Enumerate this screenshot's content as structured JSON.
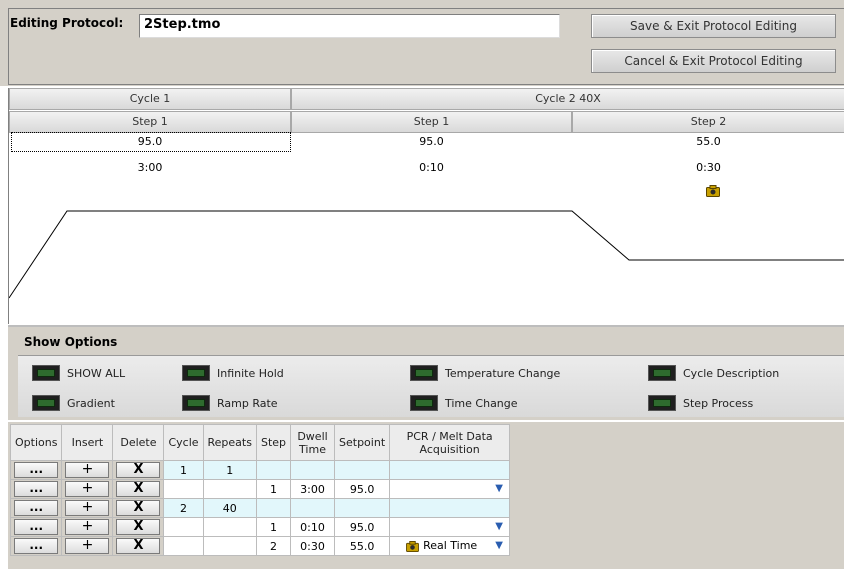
{
  "header": {
    "label": "Editing Protocol:",
    "filename": "2Step.tmo",
    "save_button": "Save & Exit Protocol Editing",
    "cancel_button": "Cancel & Exit Protocol Editing"
  },
  "graph": {
    "cycles": [
      {
        "label": "Cycle 1",
        "steps": [
          {
            "label": "Step 1",
            "setpoint": "95.0",
            "time": "3:00",
            "camera": false
          }
        ]
      },
      {
        "label": "Cycle 2 40X",
        "steps": [
          {
            "label": "Step 1",
            "setpoint": "95.0",
            "time": "0:10",
            "camera": false
          },
          {
            "label": "Step 2",
            "setpoint": "55.0",
            "time": "0:30",
            "camera": true
          }
        ]
      }
    ]
  },
  "show_options": {
    "title": "Show Options",
    "toggles": [
      {
        "label": "SHOW ALL"
      },
      {
        "label": "Gradient"
      },
      {
        "label": "Infinite Hold"
      },
      {
        "label": "Ramp Rate"
      },
      {
        "label": "Temperature Change"
      },
      {
        "label": "Time Change"
      },
      {
        "label": "Cycle Description"
      },
      {
        "label": "Step Process"
      }
    ]
  },
  "table": {
    "headers": [
      "Options",
      "Insert",
      "Delete",
      "Cycle",
      "Repeats",
      "Step",
      "Dwell Time",
      "Setpoint",
      "PCR / Melt Data Acquisition"
    ],
    "button_labels": {
      "options": "...",
      "insert": "+",
      "delete": "X"
    },
    "rows": [
      {
        "cycle": "1",
        "repeats": "1",
        "step": "",
        "dwell": "",
        "setpoint": "",
        "acquisition": "",
        "camera": false,
        "dropdown": false
      },
      {
        "cycle": "",
        "repeats": "",
        "step": "1",
        "dwell": "3:00",
        "setpoint": "95.0",
        "acquisition": "",
        "camera": false,
        "dropdown": true
      },
      {
        "cycle": "2",
        "repeats": "40",
        "step": "",
        "dwell": "",
        "setpoint": "",
        "acquisition": "",
        "camera": false,
        "dropdown": false
      },
      {
        "cycle": "",
        "repeats": "",
        "step": "1",
        "dwell": "0:10",
        "setpoint": "95.0",
        "acquisition": "",
        "camera": false,
        "dropdown": true
      },
      {
        "cycle": "",
        "repeats": "",
        "step": "2",
        "dwell": "0:30",
        "setpoint": "55.0",
        "acquisition": "Real Time",
        "camera": true,
        "dropdown": true
      }
    ]
  },
  "icons": {
    "led": "led-toggle-icon",
    "camera": "camera-icon",
    "dropdown": "chevron-down-icon"
  },
  "colors": {
    "panel": "#d4d0c8",
    "row_highlight": "#e2f7fb",
    "camera": "#c8a000",
    "led": "#2e6b2e"
  }
}
